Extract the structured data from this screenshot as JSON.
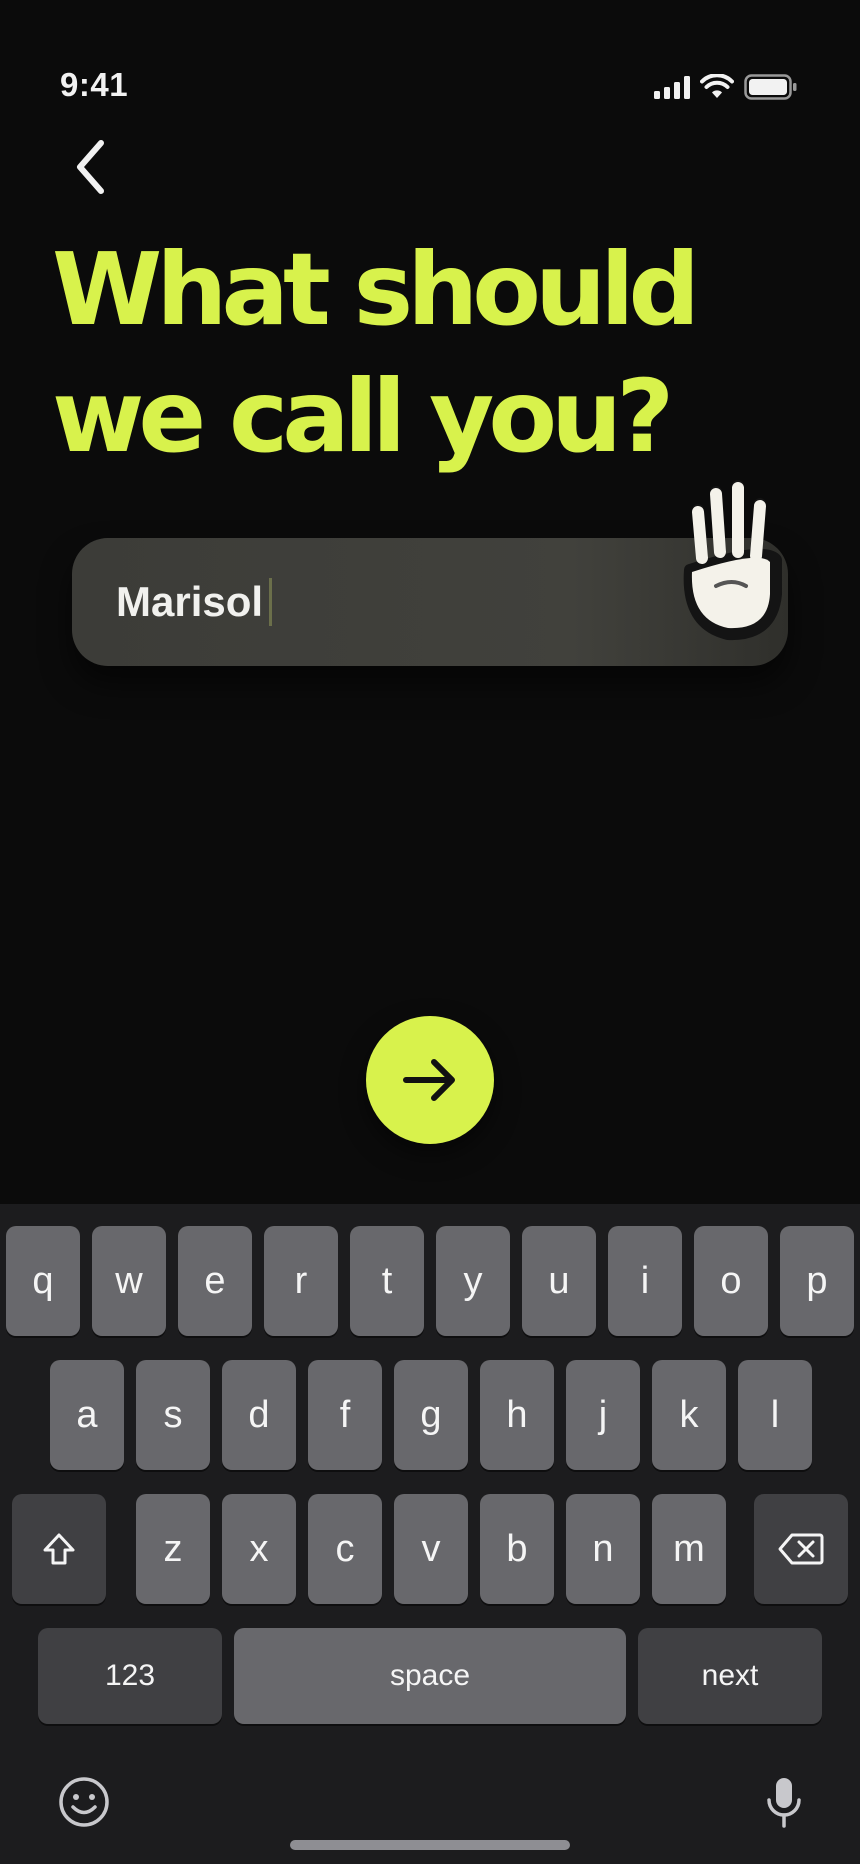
{
  "status": {
    "time": "9:41"
  },
  "heading": {
    "line1": "What should",
    "line2": "we call you?"
  },
  "name_input": {
    "value": "Marisol"
  },
  "colors": {
    "accent": "#d8f24c",
    "background": "#0b0b0b"
  },
  "icons": {
    "back": "chevron-left-icon",
    "next": "arrow-right-icon",
    "hand": "waving-hand-icon",
    "shift": "shift-icon",
    "delete": "backspace-icon",
    "emoji": "emoji-icon",
    "mic": "microphone-icon"
  },
  "keyboard": {
    "row1": [
      "q",
      "w",
      "e",
      "r",
      "t",
      "y",
      "u",
      "i",
      "o",
      "p"
    ],
    "row2": [
      "a",
      "s",
      "d",
      "f",
      "g",
      "h",
      "j",
      "k",
      "l"
    ],
    "row3": [
      "z",
      "x",
      "c",
      "v",
      "b",
      "n",
      "m"
    ],
    "numbers_label": "123",
    "space_label": "space",
    "next_label": "next"
  }
}
